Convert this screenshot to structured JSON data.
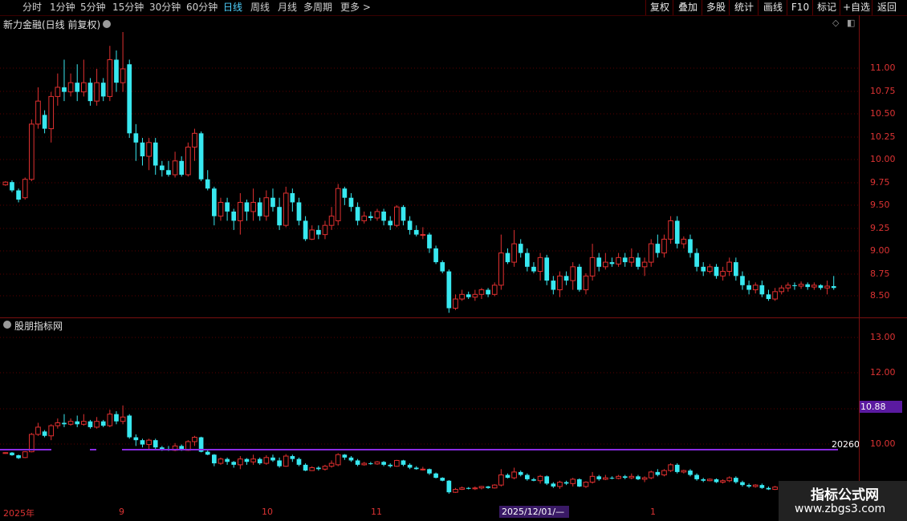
{
  "toolbar": {
    "periods": [
      "分时",
      "1分钟",
      "5分钟",
      "15分钟",
      "30分钟",
      "60分钟",
      "日线",
      "周线",
      "月线",
      "多周期",
      "更多"
    ],
    "active_period": "日线",
    "right_buttons": [
      "复权",
      "叠加",
      "多股",
      "统计",
      "画线",
      "F10",
      "标记",
      "+自选",
      "返回"
    ]
  },
  "main_panel": {
    "title": "新力金融(日线 前复权)",
    "price_axis": [
      "11.00",
      "10.75",
      "10.50",
      "10.25",
      "10.00",
      "9.75",
      "9.50",
      "9.25",
      "9.00",
      "8.75",
      "8.50"
    ]
  },
  "indicator_panel": {
    "title": "股朋指标网",
    "axis": [
      "13.00",
      "12.00",
      "10.00"
    ],
    "price_tag": "10.88",
    "flag_text": "20260"
  },
  "time_axis": {
    "labels": [
      "2025年",
      "9",
      "10",
      "11",
      "1"
    ],
    "selected_date": "2025/12/01/—"
  },
  "watermark": {
    "title": "指标公式网",
    "url": "www.zbgs3.com"
  },
  "colors": {
    "up": "#e03030",
    "down": "#38e8f0",
    "line": "#8a2be2",
    "grid": "#5a0000"
  },
  "chart_data": {
    "type": "candlestick",
    "candles": [
      [
        9.84,
        9.87,
        9.83,
        9.88
      ],
      [
        9.87,
        9.78,
        9.76,
        9.89
      ],
      [
        9.78,
        9.68,
        9.65,
        9.8
      ],
      [
        9.7,
        9.9,
        9.68,
        9.92
      ],
      [
        9.9,
        10.5,
        9.88,
        10.55
      ],
      [
        10.5,
        10.75,
        10.45,
        10.9
      ],
      [
        10.6,
        10.45,
        10.4,
        10.65
      ],
      [
        10.45,
        10.8,
        10.3,
        10.85
      ],
      [
        10.8,
        10.9,
        10.7,
        11.05
      ],
      [
        10.9,
        10.85,
        10.75,
        11.2
      ],
      [
        10.85,
        10.95,
        10.8,
        11.05
      ],
      [
        10.95,
        10.85,
        10.75,
        11.15
      ],
      [
        10.85,
        10.95,
        10.8,
        11.2
      ],
      [
        10.95,
        10.75,
        10.7,
        11.0
      ],
      [
        10.75,
        10.95,
        10.7,
        11.1
      ],
      [
        10.95,
        10.8,
        10.75,
        11.0
      ],
      [
        10.8,
        11.2,
        10.75,
        11.35
      ],
      [
        11.2,
        10.95,
        10.85,
        11.3
      ],
      [
        10.95,
        11.1,
        10.85,
        11.5
      ],
      [
        11.15,
        10.4,
        10.35,
        11.2
      ],
      [
        10.4,
        10.3,
        10.1,
        10.5
      ],
      [
        10.3,
        10.15,
        10.05,
        10.35
      ],
      [
        10.15,
        10.3,
        10.0,
        10.35
      ],
      [
        10.3,
        10.05,
        9.95,
        10.35
      ],
      [
        10.05,
        10.0,
        9.93,
        10.1
      ],
      [
        10.0,
        9.95,
        9.93,
        10.1
      ],
      [
        9.95,
        10.1,
        9.92,
        10.2
      ],
      [
        10.1,
        9.95,
        9.93,
        10.15
      ],
      [
        9.95,
        10.25,
        9.93,
        10.3
      ],
      [
        10.25,
        10.4,
        10.1,
        10.45
      ],
      [
        10.4,
        9.9,
        9.88,
        10.42
      ],
      [
        9.9,
        9.8,
        9.78,
        10.0
      ],
      [
        9.8,
        9.5,
        9.4,
        9.82
      ],
      [
        9.5,
        9.65,
        9.45,
        9.7
      ],
      [
        9.65,
        9.55,
        9.45,
        9.7
      ],
      [
        9.55,
        9.45,
        9.35,
        9.58
      ],
      [
        9.45,
        9.65,
        9.3,
        9.75
      ],
      [
        9.65,
        9.55,
        9.45,
        9.68
      ],
      [
        9.55,
        9.65,
        9.45,
        9.8
      ],
      [
        9.65,
        9.5,
        9.45,
        9.7
      ],
      [
        9.5,
        9.7,
        9.45,
        9.78
      ],
      [
        9.7,
        9.6,
        9.55,
        9.8
      ],
      [
        9.6,
        9.4,
        9.35,
        9.7
      ],
      [
        9.4,
        9.75,
        9.38,
        9.82
      ],
      [
        9.75,
        9.65,
        9.55,
        9.8
      ],
      [
        9.65,
        9.45,
        9.4,
        9.7
      ],
      [
        9.45,
        9.25,
        9.23,
        9.5
      ],
      [
        9.25,
        9.35,
        9.24,
        9.4
      ],
      [
        9.35,
        9.3,
        9.25,
        9.4
      ],
      [
        9.3,
        9.4,
        9.25,
        9.45
      ],
      [
        9.4,
        9.5,
        9.35,
        9.6
      ],
      [
        9.45,
        9.8,
        9.4,
        9.85
      ],
      [
        9.8,
        9.7,
        9.62,
        9.82
      ],
      [
        9.7,
        9.6,
        9.55,
        9.75
      ],
      [
        9.6,
        9.45,
        9.4,
        9.65
      ],
      [
        9.45,
        9.5,
        9.42,
        9.55
      ],
      [
        9.5,
        9.48,
        9.45,
        9.55
      ],
      [
        9.48,
        9.55,
        9.45,
        9.58
      ],
      [
        9.55,
        9.45,
        9.4,
        9.58
      ],
      [
        9.45,
        9.4,
        9.35,
        9.5
      ],
      [
        9.4,
        9.6,
        9.38,
        9.62
      ],
      [
        9.6,
        9.45,
        9.4,
        9.62
      ],
      [
        9.45,
        9.35,
        9.3,
        9.5
      ],
      [
        9.35,
        9.3,
        9.28,
        9.4
      ],
      [
        9.3,
        9.3,
        9.25,
        9.38
      ],
      [
        9.3,
        9.15,
        9.1,
        9.32
      ],
      [
        9.15,
        9.0,
        8.98,
        9.18
      ],
      [
        9.0,
        8.9,
        8.88,
        9.02
      ],
      [
        8.9,
        8.5,
        8.45,
        8.92
      ],
      [
        8.5,
        8.6,
        8.48,
        8.65
      ],
      [
        8.6,
        8.65,
        8.58,
        8.7
      ],
      [
        8.65,
        8.62,
        8.6,
        8.68
      ],
      [
        8.62,
        8.65,
        8.58,
        8.7
      ],
      [
        8.65,
        8.7,
        8.6,
        8.72
      ],
      [
        8.7,
        8.65,
        8.62,
        8.72
      ],
      [
        8.65,
        8.75,
        8.63,
        8.78
      ],
      [
        8.75,
        9.1,
        8.7,
        9.3
      ],
      [
        9.1,
        9.0,
        8.98,
        9.15
      ],
      [
        9.0,
        9.2,
        8.95,
        9.35
      ],
      [
        9.2,
        9.1,
        9.05,
        9.25
      ],
      [
        9.1,
        8.95,
        8.9,
        9.15
      ],
      [
        8.95,
        8.9,
        8.88,
        9.0
      ],
      [
        8.9,
        9.05,
        8.8,
        9.1
      ],
      [
        9.05,
        8.8,
        8.75,
        9.08
      ],
      [
        8.8,
        8.7,
        8.65,
        8.85
      ],
      [
        8.7,
        8.85,
        8.62,
        8.9
      ],
      [
        8.85,
        8.8,
        8.75,
        8.9
      ],
      [
        8.8,
        8.95,
        8.7,
        9.0
      ],
      [
        8.95,
        8.7,
        8.68,
        8.98
      ],
      [
        8.7,
        8.85,
        8.65,
        8.88
      ],
      [
        8.85,
        9.05,
        8.8,
        9.2
      ],
      [
        9.05,
        8.95,
        8.9,
        9.1
      ],
      [
        8.95,
        9.0,
        8.92,
        9.1
      ],
      [
        9.0,
        8.98,
        8.95,
        9.05
      ],
      [
        8.98,
        9.05,
        8.95,
        9.1
      ],
      [
        9.05,
        9.0,
        8.95,
        9.1
      ],
      [
        9.0,
        9.05,
        8.95,
        9.15
      ],
      [
        9.05,
        8.95,
        8.92,
        9.1
      ],
      [
        8.95,
        9.0,
        8.85,
        9.05
      ],
      [
        9.0,
        9.2,
        8.95,
        9.25
      ],
      [
        9.2,
        9.1,
        9.05,
        9.3
      ],
      [
        9.1,
        9.25,
        9.05,
        9.3
      ],
      [
        9.25,
        9.45,
        9.2,
        9.5
      ],
      [
        9.45,
        9.2,
        9.15,
        9.5
      ],
      [
        9.2,
        9.25,
        9.15,
        9.28
      ],
      [
        9.25,
        9.1,
        9.05,
        9.3
      ],
      [
        9.1,
        8.95,
        8.9,
        9.15
      ],
      [
        8.95,
        8.9,
        8.85,
        9.0
      ],
      [
        8.9,
        8.95,
        8.88,
        8.98
      ],
      [
        8.95,
        8.85,
        8.82,
        8.98
      ],
      [
        8.85,
        8.9,
        8.8,
        8.95
      ],
      [
        8.9,
        9.0,
        8.85,
        9.05
      ],
      [
        9.0,
        8.85,
        8.8,
        9.05
      ],
      [
        8.85,
        8.75,
        8.7,
        8.9
      ],
      [
        8.75,
        8.7,
        8.65,
        8.8
      ],
      [
        8.7,
        8.75,
        8.66,
        8.78
      ],
      [
        8.75,
        8.65,
        8.62,
        8.8
      ],
      [
        8.65,
        8.6,
        8.58,
        8.7
      ],
      [
        8.6,
        8.68,
        8.58,
        8.72
      ],
      [
        8.68,
        8.72,
        8.65,
        8.75
      ],
      [
        8.72,
        8.75,
        8.68,
        8.78
      ],
      [
        8.75,
        8.74,
        8.7,
        8.78
      ],
      [
        8.74,
        8.76,
        8.71,
        8.79
      ],
      [
        8.76,
        8.73,
        8.7,
        8.78
      ],
      [
        8.73,
        8.75,
        8.7,
        8.78
      ],
      [
        8.75,
        8.72,
        8.7,
        8.76
      ],
      [
        8.72,
        8.74,
        8.65,
        8.8
      ],
      [
        8.74,
        8.72,
        8.7,
        8.85
      ]
    ],
    "ylim": [
      8.4,
      11.5
    ]
  }
}
